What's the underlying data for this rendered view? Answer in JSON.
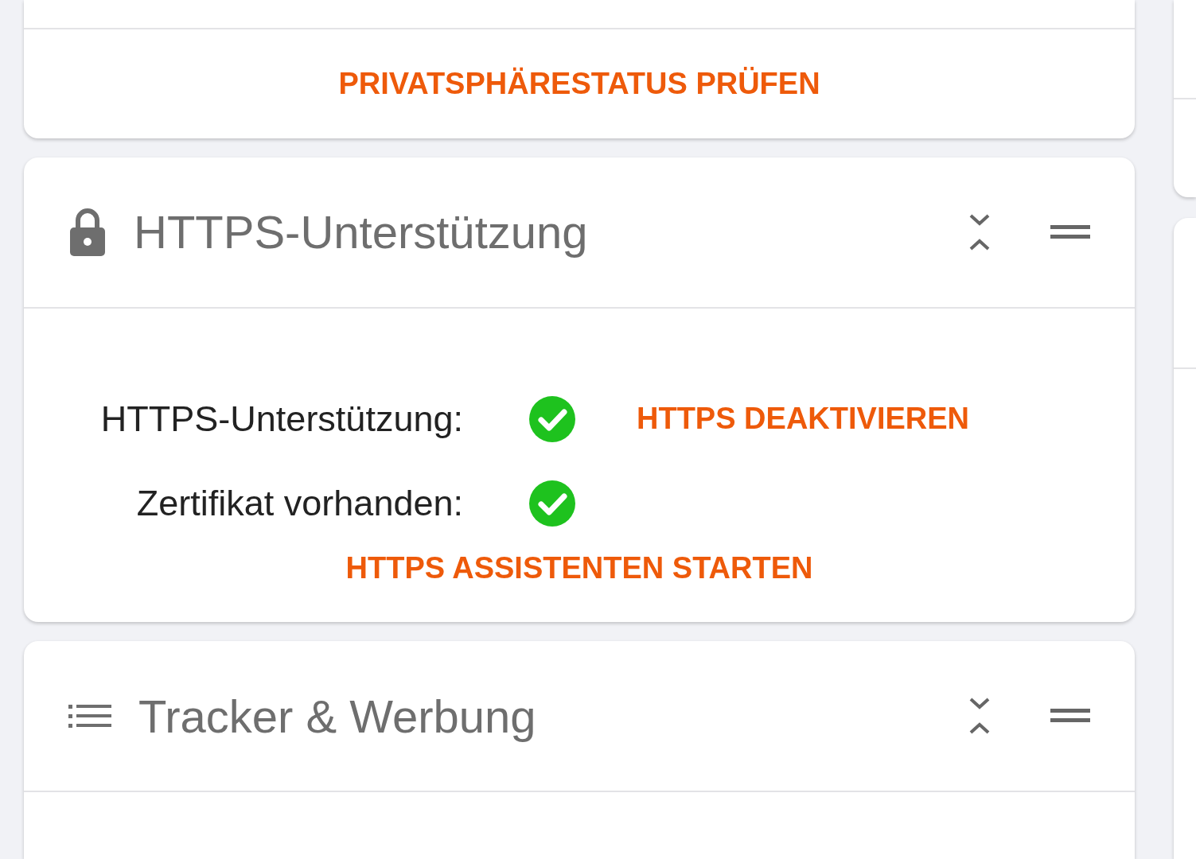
{
  "top_card": {
    "action": "PRIVATSPHÄRESTATUS PRÜFEN"
  },
  "https_card": {
    "title": "HTTPS-Unterstützung",
    "rows": [
      {
        "label": "HTTPS-Unterstützung:",
        "checked": true,
        "action": "HTTPS DEAKTIVIEREN"
      },
      {
        "label": "Zertifikat vorhanden:",
        "checked": true
      }
    ],
    "action": "HTTPS ASSISTENTEN STARTEN"
  },
  "tracker_card": {
    "title": "Tracker & Werbung"
  }
}
